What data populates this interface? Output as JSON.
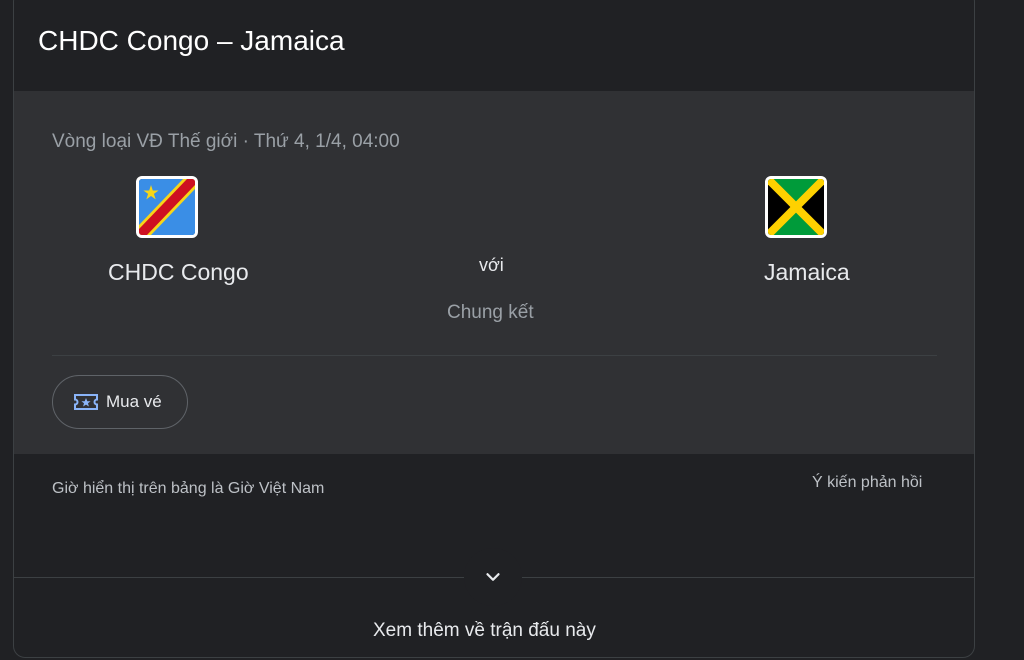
{
  "match": {
    "title": "CHDC Congo – Jamaica",
    "competition_line": "Vòng loại VĐ Thế giới · Thứ 4, 1/4, 04:00",
    "home_team": {
      "name": "CHDC Congo",
      "flag_icon": "dr-congo-flag-icon"
    },
    "away_team": {
      "name": "Jamaica",
      "flag_icon": "jamaica-flag-icon"
    },
    "versus_label": "với",
    "stage_label": "Chung kết"
  },
  "actions": {
    "buy_tickets_label": "Mua vé",
    "buy_tickets_icon": "ticket-icon"
  },
  "footer": {
    "timezone_note": "Giờ hiển thị trên bảng là Giờ Việt Nam",
    "feedback_label": "Ý kiến phản hồi",
    "more_label": "Xem thêm về trận đấu này",
    "expand_icon": "chevron-down-icon"
  },
  "colors": {
    "background": "#202124",
    "panel": "#303134",
    "text_primary": "#e8eaed",
    "text_secondary": "#9aa0a6",
    "ticket_icon": "#8ab4f8"
  }
}
